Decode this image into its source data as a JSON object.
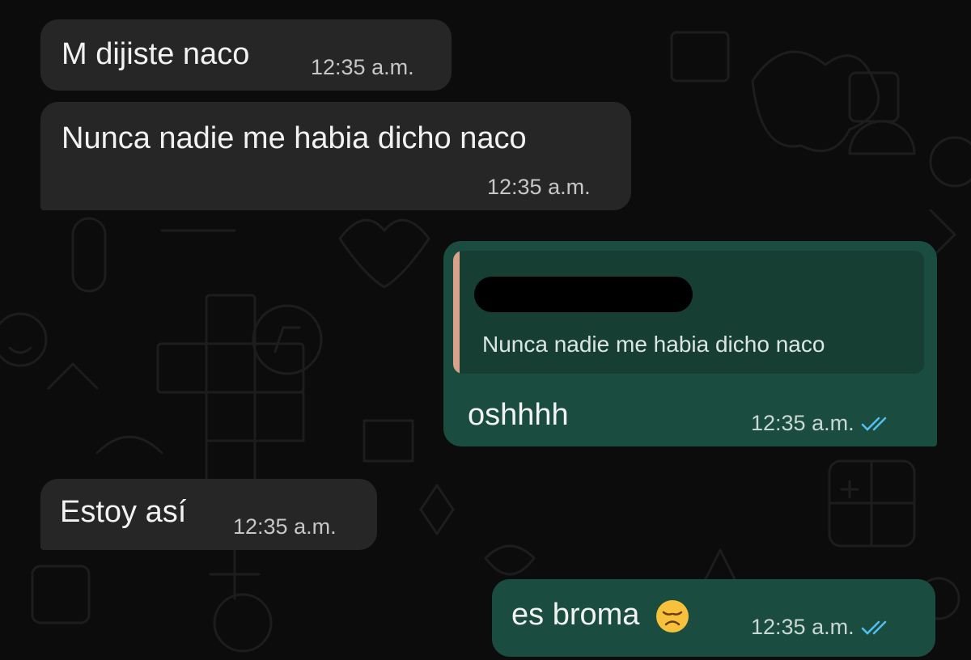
{
  "conversation": {
    "messages": [
      {
        "id": 1,
        "direction": "incoming",
        "text": "M dijiste naco",
        "time": "12:35 a.m."
      },
      {
        "id": 2,
        "direction": "incoming",
        "text": "Nunca nadie me habia dicho naco",
        "time": "12:35 a.m."
      },
      {
        "id": 3,
        "direction": "outgoing",
        "quote": {
          "author_redacted": true,
          "text": "Nunca nadie me habia dicho naco"
        },
        "text": "oshhhh",
        "time": "12:35 a.m.",
        "status": "read"
      },
      {
        "id": 4,
        "direction": "incoming",
        "text": "Estoy así",
        "time": "12:35 a.m."
      },
      {
        "id": 5,
        "direction": "outgoing",
        "text": "es broma",
        "emoji": "disappointed-face",
        "time": "12:35 a.m.",
        "status": "read"
      }
    ]
  },
  "theme": {
    "background": "#0c0c0c",
    "incoming_bubble": "#262626",
    "outgoing_bubble": "#1a4d3f",
    "quote_background": "#163e33",
    "quote_accent": "#d8a38a",
    "read_ticks": "#53bdeb"
  }
}
